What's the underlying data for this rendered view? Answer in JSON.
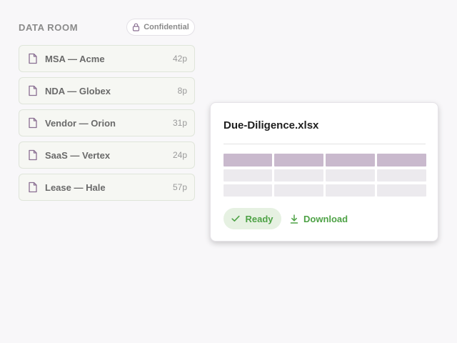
{
  "section": {
    "title": "DATA ROOM",
    "badge_label": "Confidential",
    "badge_icon": "lock-icon"
  },
  "documents": [
    {
      "name": "MSA — Acme",
      "pages": "42p",
      "icon": "file-icon"
    },
    {
      "name": "NDA — Globex",
      "pages": "8p",
      "icon": "file-icon"
    },
    {
      "name": "Vendor — Orion",
      "pages": "31p",
      "icon": "file-icon"
    },
    {
      "name": "SaaS — Vertex",
      "pages": "24p",
      "icon": "file-icon"
    },
    {
      "name": "Lease — Hale",
      "pages": "57p",
      "icon": "file-icon"
    }
  ],
  "preview": {
    "filename": "Due-Diligence.xlsx",
    "status_label": "Ready",
    "status_icon": "check-icon",
    "download_label": "Download",
    "download_icon": "download-icon"
  },
  "colors": {
    "accent_green": "#4ea246",
    "file_icon_purple": "#8a6f92",
    "sheet_header": "#c9b9cd",
    "sheet_cell": "#eceaee"
  }
}
